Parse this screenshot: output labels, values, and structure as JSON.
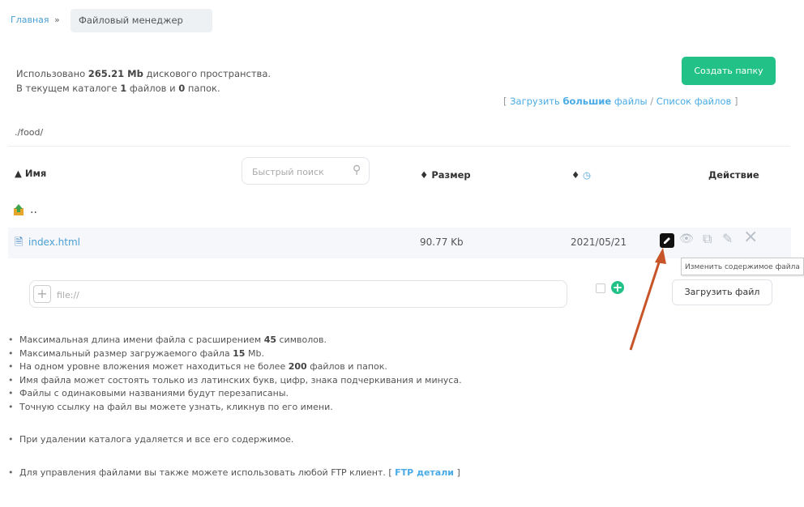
{
  "breadcrumb": {
    "home": "Главная",
    "separator": "»",
    "current": "Файловый менеджер"
  },
  "usage": {
    "prefix": "Использовано",
    "amount": "265.21 Mb",
    "suffix": "дискового пространства.",
    "catalog_prefix": "В текущем каталоге",
    "files_count": "1",
    "files_word": "файлов и",
    "folders_count": "0",
    "folders_word": "папок."
  },
  "buttons": {
    "create_folder": "Создать папку",
    "upload_file": "Загрузить файл"
  },
  "upload_links": {
    "open_bracket": "[",
    "upload_prefix": "Загрузить",
    "upload_big": "большие",
    "upload_suffix": "файлы",
    "slash": "/",
    "file_list": "Список файлов",
    "close_bracket": "]"
  },
  "path": "./food/",
  "table": {
    "headers": {
      "name": "Имя",
      "search_placeholder": "Быстрый поиск",
      "size": "Размер",
      "action": "Действие"
    },
    "up_row": "..",
    "files": [
      {
        "name": "index.html",
        "size": "90.77 Kb",
        "date": "2021/05/21"
      }
    ]
  },
  "tooltip": "Изменить содержимое файла",
  "file_input": {
    "placeholder": "file://"
  },
  "notes": [
    {
      "pre": "Максимальная длина имени файла с расширением",
      "b": "45",
      "post": "символов."
    },
    {
      "pre": "Максимальный размер загружаемого файла",
      "b": "15",
      "post": "Mb."
    },
    {
      "pre": "На одном уровне вложения может находиться не более",
      "b": "200",
      "post": "файлов и папок."
    },
    {
      "pre": "Имя файла может состоять только из латинских букв, цифр, знака подчеркивания и минуса.",
      "b": "",
      "post": ""
    },
    {
      "pre": "Файлы с одинаковыми названиями будут перезаписаны.",
      "b": "",
      "post": ""
    },
    {
      "pre": "Точную ссылку на файл вы можете узнать, кликнув по его имени.",
      "b": "",
      "post": ""
    }
  ],
  "notes_extra": [
    "При удалении каталога удаляется и все его содержимое."
  ],
  "ftp_note": {
    "text": "Для управления файлами вы также можете использовать любой FTP клиент.",
    "open": "[",
    "link": "FTP детали",
    "close": "]"
  },
  "colors": {
    "accent_green": "#22c187",
    "link_blue": "#48abe5",
    "arrow": "#c8552a"
  }
}
